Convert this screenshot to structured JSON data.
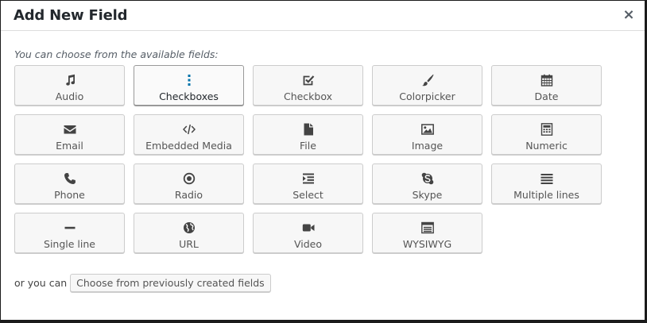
{
  "dialog": {
    "title": "Add New Field",
    "close_symbol": "×",
    "intro": "You can choose from the available fields:"
  },
  "colors": {
    "icon": "#444444",
    "accent": "#0073aa",
    "button_bg": "#f7f7f7",
    "button_border": "#cccccc"
  },
  "fields": [
    {
      "label": "Audio",
      "icon": "music-icon"
    },
    {
      "label": "Checkboxes",
      "icon": "vertical-ellipsis-icon",
      "active": true
    },
    {
      "label": "Checkbox",
      "icon": "checkbox-icon"
    },
    {
      "label": "Colorpicker",
      "icon": "paintbrush-icon"
    },
    {
      "label": "Date",
      "icon": "calendar-icon"
    },
    {
      "label": "Email",
      "icon": "envelope-icon"
    },
    {
      "label": "Embedded Media",
      "icon": "code-icon"
    },
    {
      "label": "File",
      "icon": "file-icon"
    },
    {
      "label": "Image",
      "icon": "image-icon"
    },
    {
      "label": "Numeric",
      "icon": "calculator-icon"
    },
    {
      "label": "Phone",
      "icon": "phone-icon"
    },
    {
      "label": "Radio",
      "icon": "radio-icon"
    },
    {
      "label": "Select",
      "icon": "select-list-icon"
    },
    {
      "label": "Skype",
      "icon": "skype-icon"
    },
    {
      "label": "Multiple lines",
      "icon": "lines-icon"
    },
    {
      "label": "Single line",
      "icon": "minus-icon"
    },
    {
      "label": "URL",
      "icon": "globe-icon"
    },
    {
      "label": "Video",
      "icon": "video-camera-icon"
    },
    {
      "label": "WYSIWYG",
      "icon": "editor-window-icon"
    }
  ],
  "footer": {
    "or_text": "or you can",
    "previous_button": "Choose from previously created fields"
  }
}
